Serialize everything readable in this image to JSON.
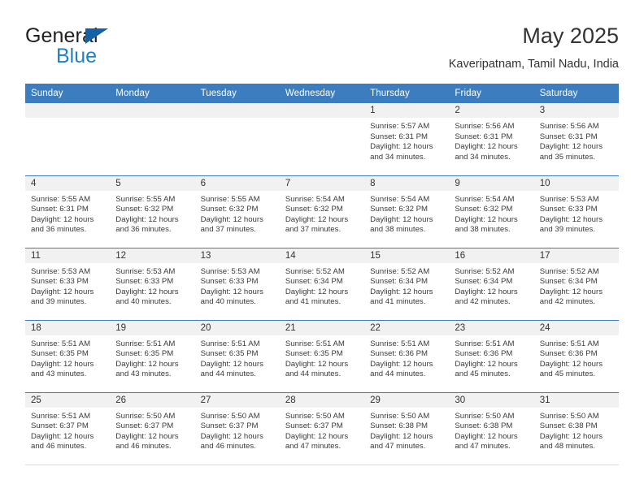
{
  "logo": {
    "word1": "General",
    "word2": "Blue",
    "triangle_color": "#1462a5",
    "word2_color": "#1e80c6"
  },
  "header": {
    "title": "May 2025",
    "subtitle": "Kaveripatnam, Tamil Nadu, India"
  },
  "theme": {
    "header_blue": "#3b7dbf",
    "daynum_band": "#f1f1f1",
    "text": "#3a3a3a"
  },
  "calendar": {
    "weekday_headers": [
      "Sunday",
      "Monday",
      "Tuesday",
      "Wednesday",
      "Thursday",
      "Friday",
      "Saturday"
    ],
    "weeks": [
      [
        {
          "day": "",
          "sunrise": "",
          "sunset": "",
          "daylight": ""
        },
        {
          "day": "",
          "sunrise": "",
          "sunset": "",
          "daylight": ""
        },
        {
          "day": "",
          "sunrise": "",
          "sunset": "",
          "daylight": ""
        },
        {
          "day": "",
          "sunrise": "",
          "sunset": "",
          "daylight": ""
        },
        {
          "day": "1",
          "sunrise": "Sunrise: 5:57 AM",
          "sunset": "Sunset: 6:31 PM",
          "daylight": "Daylight: 12 hours and 34 minutes."
        },
        {
          "day": "2",
          "sunrise": "Sunrise: 5:56 AM",
          "sunset": "Sunset: 6:31 PM",
          "daylight": "Daylight: 12 hours and 34 minutes."
        },
        {
          "day": "3",
          "sunrise": "Sunrise: 5:56 AM",
          "sunset": "Sunset: 6:31 PM",
          "daylight": "Daylight: 12 hours and 35 minutes."
        }
      ],
      [
        {
          "day": "4",
          "sunrise": "Sunrise: 5:55 AM",
          "sunset": "Sunset: 6:31 PM",
          "daylight": "Daylight: 12 hours and 36 minutes."
        },
        {
          "day": "5",
          "sunrise": "Sunrise: 5:55 AM",
          "sunset": "Sunset: 6:32 PM",
          "daylight": "Daylight: 12 hours and 36 minutes."
        },
        {
          "day": "6",
          "sunrise": "Sunrise: 5:55 AM",
          "sunset": "Sunset: 6:32 PM",
          "daylight": "Daylight: 12 hours and 37 minutes."
        },
        {
          "day": "7",
          "sunrise": "Sunrise: 5:54 AM",
          "sunset": "Sunset: 6:32 PM",
          "daylight": "Daylight: 12 hours and 37 minutes."
        },
        {
          "day": "8",
          "sunrise": "Sunrise: 5:54 AM",
          "sunset": "Sunset: 6:32 PM",
          "daylight": "Daylight: 12 hours and 38 minutes."
        },
        {
          "day": "9",
          "sunrise": "Sunrise: 5:54 AM",
          "sunset": "Sunset: 6:32 PM",
          "daylight": "Daylight: 12 hours and 38 minutes."
        },
        {
          "day": "10",
          "sunrise": "Sunrise: 5:53 AM",
          "sunset": "Sunset: 6:33 PM",
          "daylight": "Daylight: 12 hours and 39 minutes."
        }
      ],
      [
        {
          "day": "11",
          "sunrise": "Sunrise: 5:53 AM",
          "sunset": "Sunset: 6:33 PM",
          "daylight": "Daylight: 12 hours and 39 minutes."
        },
        {
          "day": "12",
          "sunrise": "Sunrise: 5:53 AM",
          "sunset": "Sunset: 6:33 PM",
          "daylight": "Daylight: 12 hours and 40 minutes."
        },
        {
          "day": "13",
          "sunrise": "Sunrise: 5:53 AM",
          "sunset": "Sunset: 6:33 PM",
          "daylight": "Daylight: 12 hours and 40 minutes."
        },
        {
          "day": "14",
          "sunrise": "Sunrise: 5:52 AM",
          "sunset": "Sunset: 6:34 PM",
          "daylight": "Daylight: 12 hours and 41 minutes."
        },
        {
          "day": "15",
          "sunrise": "Sunrise: 5:52 AM",
          "sunset": "Sunset: 6:34 PM",
          "daylight": "Daylight: 12 hours and 41 minutes."
        },
        {
          "day": "16",
          "sunrise": "Sunrise: 5:52 AM",
          "sunset": "Sunset: 6:34 PM",
          "daylight": "Daylight: 12 hours and 42 minutes."
        },
        {
          "day": "17",
          "sunrise": "Sunrise: 5:52 AM",
          "sunset": "Sunset: 6:34 PM",
          "daylight": "Daylight: 12 hours and 42 minutes."
        }
      ],
      [
        {
          "day": "18",
          "sunrise": "Sunrise: 5:51 AM",
          "sunset": "Sunset: 6:35 PM",
          "daylight": "Daylight: 12 hours and 43 minutes."
        },
        {
          "day": "19",
          "sunrise": "Sunrise: 5:51 AM",
          "sunset": "Sunset: 6:35 PM",
          "daylight": "Daylight: 12 hours and 43 minutes."
        },
        {
          "day": "20",
          "sunrise": "Sunrise: 5:51 AM",
          "sunset": "Sunset: 6:35 PM",
          "daylight": "Daylight: 12 hours and 44 minutes."
        },
        {
          "day": "21",
          "sunrise": "Sunrise: 5:51 AM",
          "sunset": "Sunset: 6:35 PM",
          "daylight": "Daylight: 12 hours and 44 minutes."
        },
        {
          "day": "22",
          "sunrise": "Sunrise: 5:51 AM",
          "sunset": "Sunset: 6:36 PM",
          "daylight": "Daylight: 12 hours and 44 minutes."
        },
        {
          "day": "23",
          "sunrise": "Sunrise: 5:51 AM",
          "sunset": "Sunset: 6:36 PM",
          "daylight": "Daylight: 12 hours and 45 minutes."
        },
        {
          "day": "24",
          "sunrise": "Sunrise: 5:51 AM",
          "sunset": "Sunset: 6:36 PM",
          "daylight": "Daylight: 12 hours and 45 minutes."
        }
      ],
      [
        {
          "day": "25",
          "sunrise": "Sunrise: 5:51 AM",
          "sunset": "Sunset: 6:37 PM",
          "daylight": "Daylight: 12 hours and 46 minutes."
        },
        {
          "day": "26",
          "sunrise": "Sunrise: 5:50 AM",
          "sunset": "Sunset: 6:37 PM",
          "daylight": "Daylight: 12 hours and 46 minutes."
        },
        {
          "day": "27",
          "sunrise": "Sunrise: 5:50 AM",
          "sunset": "Sunset: 6:37 PM",
          "daylight": "Daylight: 12 hours and 46 minutes."
        },
        {
          "day": "28",
          "sunrise": "Sunrise: 5:50 AM",
          "sunset": "Sunset: 6:37 PM",
          "daylight": "Daylight: 12 hours and 47 minutes."
        },
        {
          "day": "29",
          "sunrise": "Sunrise: 5:50 AM",
          "sunset": "Sunset: 6:38 PM",
          "daylight": "Daylight: 12 hours and 47 minutes."
        },
        {
          "day": "30",
          "sunrise": "Sunrise: 5:50 AM",
          "sunset": "Sunset: 6:38 PM",
          "daylight": "Daylight: 12 hours and 47 minutes."
        },
        {
          "day": "31",
          "sunrise": "Sunrise: 5:50 AM",
          "sunset": "Sunset: 6:38 PM",
          "daylight": "Daylight: 12 hours and 48 minutes."
        }
      ]
    ]
  }
}
